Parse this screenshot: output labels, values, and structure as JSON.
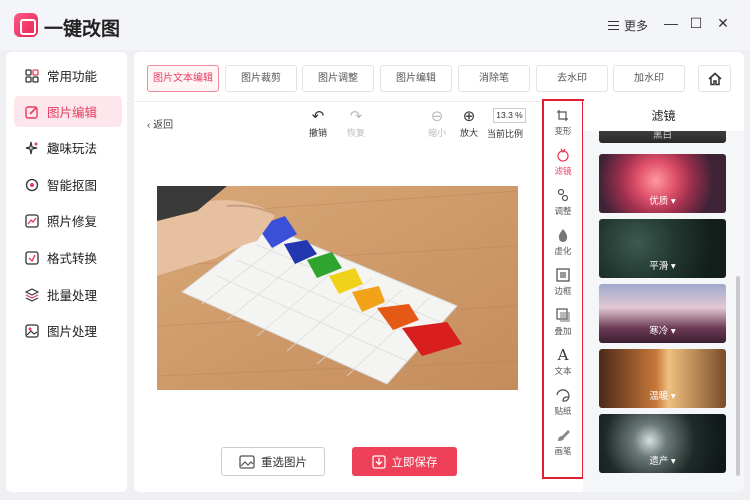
{
  "app": {
    "title": "一键改图"
  },
  "window": {
    "more_label": "更多",
    "minimize": "—",
    "maximize": "☐",
    "close": "✕"
  },
  "sidebar": {
    "items": [
      {
        "label": "常用功能",
        "icon": "grid-icon"
      },
      {
        "label": "图片编辑",
        "icon": "image-edit-icon",
        "active": true
      },
      {
        "label": "趣味玩法",
        "icon": "sparkle-icon"
      },
      {
        "label": "智能抠图",
        "icon": "cutout-icon"
      },
      {
        "label": "照片修复",
        "icon": "photo-repair-icon"
      },
      {
        "label": "格式转换",
        "icon": "format-convert-icon"
      },
      {
        "label": "批量处理",
        "icon": "layers-icon"
      },
      {
        "label": "图片处理",
        "icon": "image-process-icon"
      }
    ]
  },
  "tabs": [
    {
      "label": "图片文本编辑",
      "active": true
    },
    {
      "label": "图片裁剪"
    },
    {
      "label": "图片调整"
    },
    {
      "label": "图片编辑"
    },
    {
      "label": "消除笔"
    },
    {
      "label": "去水印"
    },
    {
      "label": "加水印"
    }
  ],
  "editor": {
    "back_label": "返回",
    "undo_label": "撤销",
    "redo_label": "恢复",
    "zoom_out_label": "缩小",
    "zoom_in_label": "放大",
    "zoom_value": "13.3 %",
    "current_ratio_label": "当前比例"
  },
  "actions": {
    "reselect_label": "重选图片",
    "save_label": "立即保存"
  },
  "vertical_tools": [
    {
      "label": "变形"
    },
    {
      "label": "滤镜",
      "active": true
    },
    {
      "label": "调整"
    },
    {
      "label": "虚化"
    },
    {
      "label": "边框"
    },
    {
      "label": "叠加"
    },
    {
      "label": "文本"
    },
    {
      "label": "贴纸"
    },
    {
      "label": "画笔"
    }
  ],
  "filter_panel": {
    "title": "滤镜",
    "filters": [
      {
        "label": "黑白"
      },
      {
        "label": "优质"
      },
      {
        "label": "平滑"
      },
      {
        "label": "寒冷"
      },
      {
        "label": "温暖"
      },
      {
        "label": "遗产"
      }
    ]
  },
  "colors": {
    "accent": "#e63d5f",
    "save_button": "#ee4058",
    "highlight_border": "#e02030"
  }
}
